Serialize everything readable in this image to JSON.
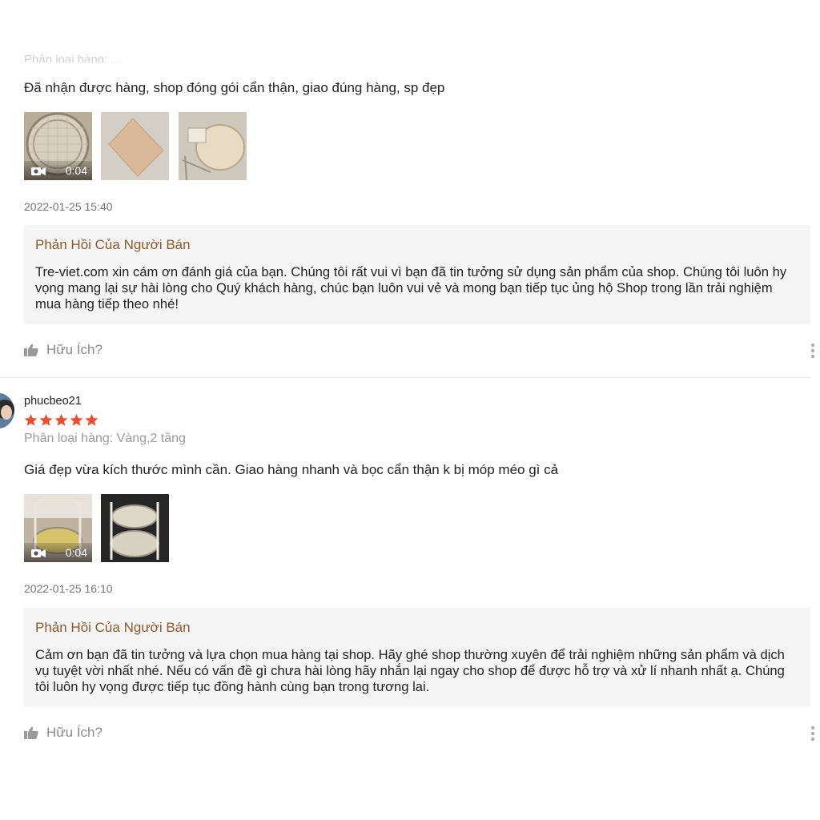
{
  "colors": {
    "accent_star": "#ee4d2d",
    "seller_title": "#8b5a2b",
    "reply_bg": "#f5f5f5"
  },
  "reviews": [
    {
      "comment": "Đã nhận được hàng, shop đóng gói cẩn thận, giao đúng hàng, sp đẹp",
      "media": [
        {
          "type": "video",
          "duration": "0:04",
          "icon": "camera-icon"
        },
        {
          "type": "image"
        },
        {
          "type": "image"
        }
      ],
      "date": "2022-01-25 15:40",
      "seller_reply": {
        "title": "Phản Hồi Của Người Bán",
        "text": "Tre-viet.com xin cám ơn đánh giá của bạn. Chúng tôi rất vui vì bạn đã tin tưởng sử dụng sản phẩm của shop. Chúng tôi luôn hy vọng mang lại sự hài lòng cho Quý khách hàng, chúc bạn luôn vui vẻ và mong bạn tiếp tục ủng hộ Shop trong lần trải nghiệm mua hàng tiếp theo nhé!"
      },
      "helpful_label": "Hữu Ích?"
    },
    {
      "username": "phucbeo21",
      "rating": 5,
      "variation": "Phân loại hàng: Vàng,2 tầng",
      "comment": "Giá đẹp vừa kích thước mình cần. Giao hàng nhanh và bọc cẩn thận k bị móp méo gì cả",
      "media": [
        {
          "type": "video",
          "duration": "0:04",
          "icon": "camera-icon"
        },
        {
          "type": "image"
        }
      ],
      "date": "2022-01-25 16:10",
      "seller_reply": {
        "title": "Phản Hồi Của Người Bán",
        "text": "Cảm ơn bạn đã tin tưởng và lựa chọn mua hàng tại shop. Hãy ghé shop thường xuyên để trải nghiệm những sản phẩm và dịch vụ tuyệt vời nhất nhé. Nếu có vấn đề gì chưa hài lòng hãy nhắn lại ngay cho shop để được hỗ trợ và xử lí nhanh nhất ạ. Chúng tôi luôn hy vọng được tiếp tục đồng hành cùng bạn trong tương lai."
      },
      "helpful_label": "Hữu Ích?"
    }
  ]
}
